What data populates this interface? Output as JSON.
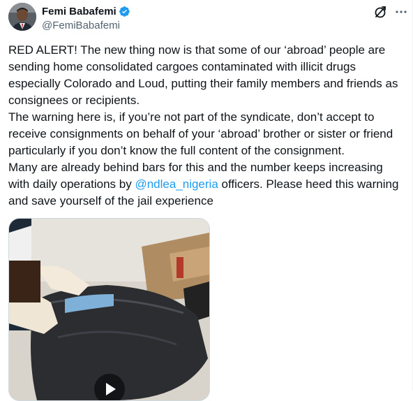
{
  "author": {
    "display_name": "Femi Babafemi",
    "handle": "@FemiBabafemi",
    "verified": true,
    "verified_color": "#1d9bf0"
  },
  "tweet": {
    "text_p1": "RED ALERT! The new thing now is that some of our ‘abroad’ people are sending home consolidated cargoes contaminated with illicit drugs especially Colorado and Loud, putting their family members and friends as consignees or recipients.\nThe warning here is, if you’re not part of the syndicate, don’t accept to receive consignments on behalf of your ‘abroad’ brother or sister or friend particularly if you don’t know the full content of the consignment.\nMany are already behind bars for this and the number keeps increasing with daily operations by ",
    "mention": "@ndlea_nigeria",
    "text_p2": " officers. Please heed this warning and save yourself of the jail experience"
  },
  "icons": {
    "grok": "grok-icon",
    "more": "more-icon",
    "play": "play-icon"
  },
  "colors": {
    "text": "#0f1419",
    "secondary": "#536471",
    "link": "#1d9bf0"
  }
}
